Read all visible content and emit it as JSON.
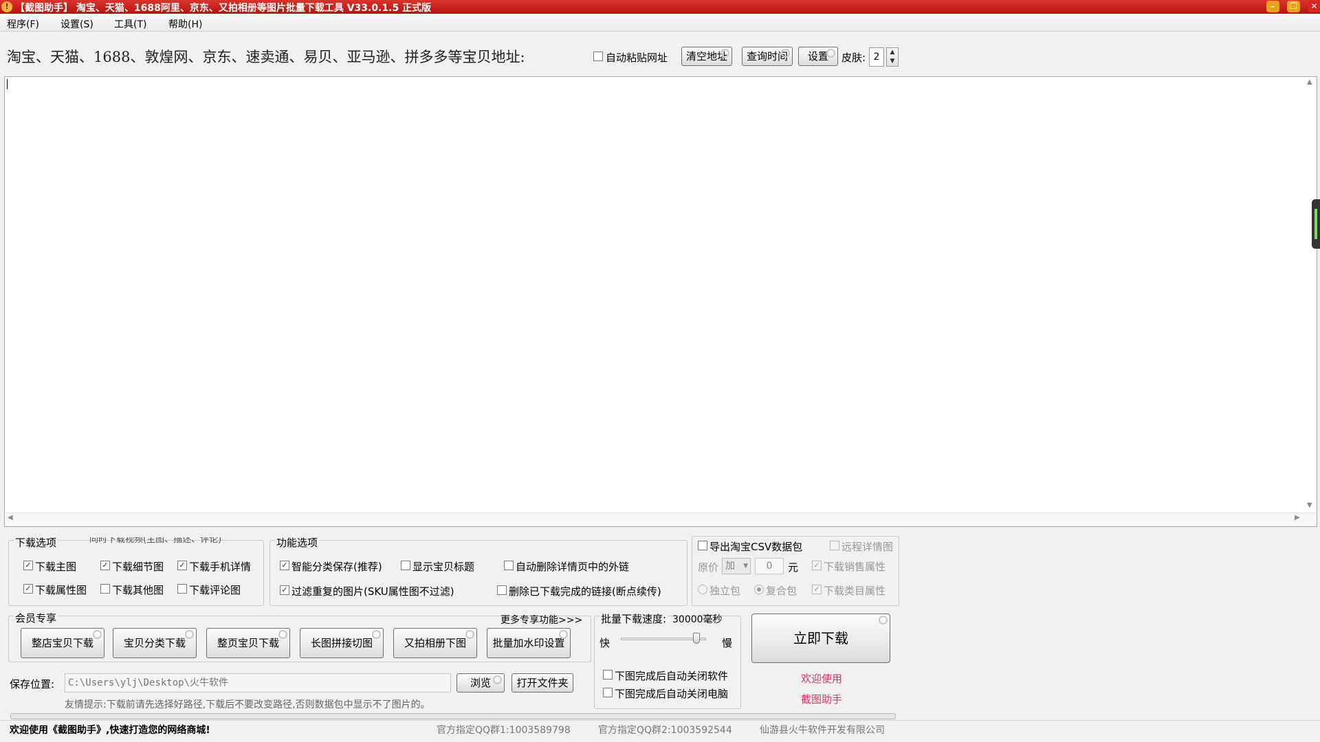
{
  "window": {
    "title": "【截图助手】 淘宝、天猫、1688阿里、京东、又拍相册等图片批量下载工具 V33.0.1.5 正式版",
    "icon_glyph": "!",
    "controls": {
      "minimize": "–",
      "maximize": "❐",
      "close": "✕"
    }
  },
  "menu": [
    "程序(F)",
    "设置(S)",
    "工具(T)",
    "帮助(H)"
  ],
  "toolbar": {
    "url_label": "淘宝、天猫、1688、敦煌网、京东、速卖通、易贝、亚马逊、拼多多等宝贝地址:",
    "auto_paste_label": "自动粘贴网址",
    "auto_paste_checked": false,
    "clear_button": "清空地址",
    "query_time_button": "查询时间",
    "settings_button": "设置",
    "skin_label": "皮肤:",
    "skin_value": "2",
    "spin_up": "▲",
    "spin_down": "▼"
  },
  "scroll_glyphs": {
    "up": "▲",
    "down": "▼",
    "left": "◀",
    "right": "▶"
  },
  "download_options": {
    "title": "下载选项",
    "hidden_item": "同时下载视频(主图、描述、评论)",
    "items": [
      {
        "label": "下载主图",
        "checked": true
      },
      {
        "label": "下载细节图",
        "checked": true
      },
      {
        "label": "下载手机详情",
        "checked": true
      },
      {
        "label": "下载属性图",
        "checked": true
      },
      {
        "label": "下载其他图",
        "checked": false
      },
      {
        "label": "下载评论图",
        "checked": false
      }
    ]
  },
  "function_options": {
    "title": "功能选项",
    "items": [
      {
        "label": "智能分类保存(推荐)",
        "checked": true
      },
      {
        "label": "显示宝贝标题",
        "checked": false
      },
      {
        "label": "自动删除详情页中的外链",
        "checked": false
      },
      {
        "label": "过滤重复的图片(SKU属性图不过滤)",
        "checked": true
      },
      {
        "label": "删除已下载完成的链接(断点续传)",
        "checked": false
      }
    ]
  },
  "csv_options": {
    "export_csv": {
      "label": "导出淘宝CSV数据包",
      "checked": false
    },
    "remote_detail": {
      "label": "远程详情图",
      "checked": false
    },
    "price_label": "原价",
    "price_op": "加",
    "price_value": "0",
    "price_unit": "元",
    "sales_attr": {
      "label": "下载销售属性",
      "checked": true
    },
    "single_pack": {
      "label": "独立包",
      "selected": false
    },
    "compound_pack": {
      "label": "复合包",
      "selected": true
    },
    "category_attr": {
      "label": "下载类目属性",
      "checked": true
    }
  },
  "member": {
    "title": "会员专享",
    "more": "更多专享功能>>>",
    "buttons": [
      "整店宝贝下载",
      "宝贝分类下载",
      "整页宝贝下载",
      "长图拼接切图",
      "又拍相册下图",
      "批量加水印设置"
    ]
  },
  "speed": {
    "label": "批量下载速度:",
    "value": "30000毫秒",
    "fast": "快",
    "slow": "慢",
    "slider_fraction": 0.92
  },
  "after_download": [
    {
      "label": "下图完成后自动关闭软件",
      "checked": false
    },
    {
      "label": "下图完成后自动关闭电脑",
      "checked": false
    }
  ],
  "start_button": "立即下载",
  "welcome": {
    "line1": "欢迎使用",
    "line2": "截图助手"
  },
  "save": {
    "label": "保存位置:",
    "path": "C:\\Users\\ylj\\Desktop\\火牛软件",
    "browse": "浏览",
    "open_folder": "打开文件夹",
    "hint": "友情提示:下载前请先选择好路径,下载后不要改变路径,否则数据包中显示不了图片的。"
  },
  "status": {
    "welcome": "欢迎使用《截图助手》,快速打造您的网络商城!",
    "qq1": "官方指定QQ群1:1003589798",
    "qq2": "官方指定QQ群2:1003592544",
    "company": "仙游县火牛软件开发有限公司"
  },
  "check_mark": "✓"
}
